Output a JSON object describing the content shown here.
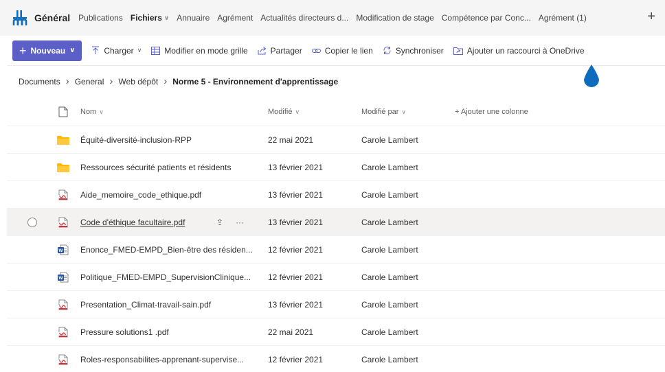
{
  "header": {
    "channel_title": "Général",
    "tabs": [
      {
        "label": "Publications",
        "active": false,
        "has_chevron": false
      },
      {
        "label": "Fichiers",
        "active": true,
        "has_chevron": true
      },
      {
        "label": "Annuaire",
        "active": false,
        "has_chevron": false
      },
      {
        "label": "Agrément",
        "active": false,
        "has_chevron": false
      },
      {
        "label": "Actualités directeurs d...",
        "active": false,
        "has_chevron": false
      },
      {
        "label": "Modification de stage",
        "active": false,
        "has_chevron": false
      },
      {
        "label": "Compétence par Conc...",
        "active": false,
        "has_chevron": false
      },
      {
        "label": "Agrément (1)",
        "active": false,
        "has_chevron": false
      }
    ],
    "add_tab_symbol": "+"
  },
  "toolbar": {
    "new_label": "Nouveau",
    "items": [
      {
        "label": "Charger",
        "icon": "upload-icon",
        "has_chevron": true
      },
      {
        "label": "Modifier en mode grille",
        "icon": "grid-icon",
        "has_chevron": false
      },
      {
        "label": "Partager",
        "icon": "share-icon",
        "has_chevron": false
      },
      {
        "label": "Copier le lien",
        "icon": "link-icon",
        "has_chevron": false
      },
      {
        "label": "Synchroniser",
        "icon": "sync-icon",
        "has_chevron": false
      },
      {
        "label": "Ajouter un raccourci à OneDrive",
        "icon": "shortcut-icon",
        "has_chevron": false
      }
    ]
  },
  "breadcrumb": {
    "items": [
      "Documents",
      "General",
      "Web dépôt"
    ],
    "current": "Norme 5 - Environnement d'apprentissage"
  },
  "columns": {
    "name": "Nom",
    "modified": "Modifié",
    "modified_by": "Modifié par",
    "add_column": "+ Ajouter une colonne"
  },
  "files": [
    {
      "name": "Équité-diversité-inclusion-RPP",
      "type": "folder",
      "modified": "22 mai 2021",
      "modified_by": "Carole Lambert"
    },
    {
      "name": "Ressources sécurité patients et résidents",
      "type": "folder",
      "modified": "13 février 2021",
      "modified_by": "Carole Lambert"
    },
    {
      "name": "Aide_memoire_code_ethique.pdf",
      "type": "pdf",
      "modified": "13 février 2021",
      "modified_by": "Carole Lambert"
    },
    {
      "name": "Code d'éthique facultaire.pdf",
      "type": "pdf",
      "modified": "13 février 2021",
      "modified_by": "Carole Lambert",
      "hover": true
    },
    {
      "name": "Enonce_FMED-EMPD_Bien-être des résiden...",
      "type": "word",
      "modified": "12 février 2021",
      "modified_by": "Carole Lambert"
    },
    {
      "name": "Politique_FMED-EMPD_SupervisionClinique...",
      "type": "word",
      "modified": "12 février 2021",
      "modified_by": "Carole Lambert"
    },
    {
      "name": "Presentation_Climat-travail-sain.pdf",
      "type": "pdf",
      "modified": "13 février 2021",
      "modified_by": "Carole Lambert"
    },
    {
      "name": "Pressure solutions1 .pdf",
      "type": "pdf",
      "modified": "22 mai 2021",
      "modified_by": "Carole Lambert"
    },
    {
      "name": "Roles-responsabilites-apprenant-supervise...",
      "type": "pdf",
      "modified": "12 février 2021",
      "modified_by": "Carole Lambert"
    }
  ],
  "row_actions": {
    "share_symbol": "⇪",
    "more_symbol": "···"
  },
  "colors": {
    "accent": "#5b5fc7",
    "folder": "#ffb900",
    "pdf": "#d13438",
    "word": "#2b579a",
    "drop": "#0f6cbd"
  }
}
